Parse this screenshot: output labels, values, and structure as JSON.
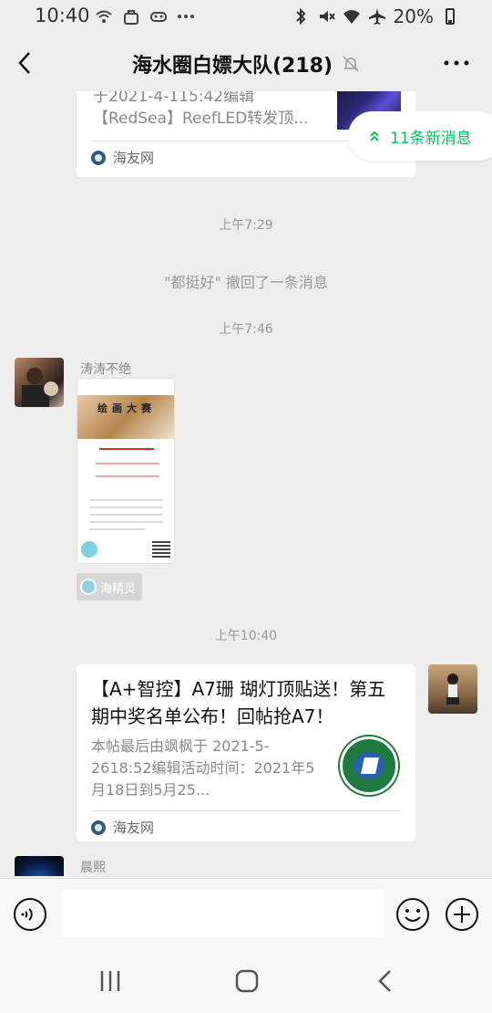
{
  "status_bar": {
    "time": "10:40",
    "battery": "20%"
  },
  "header": {
    "title": "海水圈白嫖大队(218)"
  },
  "messages": {
    "card1": {
      "line1": "于2021-4-115:42编辑",
      "line2": "【RedSea】ReefLED转发顶...",
      "source": "海友网"
    },
    "new_messages": "11条新消息",
    "time1": "上午7:29",
    "recall": "\"都挺好\" 撤回了一条消息",
    "time2": "上午7:46",
    "sender1": "涛涛不绝",
    "mini_card": {
      "banner_title": "绘画大赛",
      "app_name": "海精灵"
    },
    "time3": "上午10:40",
    "card2": {
      "title": "【A+智控】A7珊 瑚灯顶贴送！第五期中奖名单公布！回帖抢A7！",
      "desc": "本帖最后由飒枫于 2021-5-2618:52编辑活动时间：2021年5月18日到5月25...",
      "source": "海友网"
    },
    "sender2": "晨熙"
  },
  "input": {
    "placeholder": ""
  }
}
